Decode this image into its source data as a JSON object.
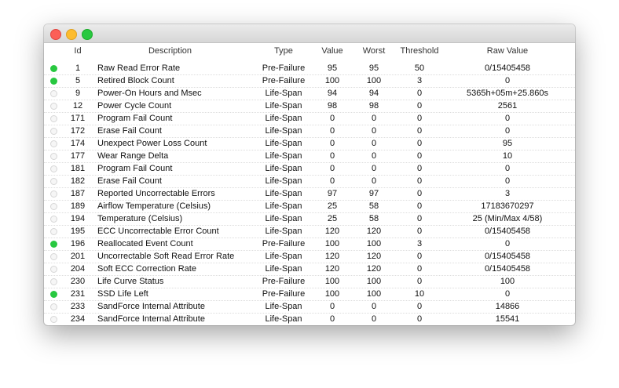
{
  "colors": {
    "status_ok": "#28c840"
  },
  "columns": {
    "id": "Id",
    "description": "Description",
    "type": "Type",
    "value": "Value",
    "worst": "Worst",
    "threshold": "Threshold",
    "raw": "Raw Value"
  },
  "rows": [
    {
      "status": "ok",
      "id": "1",
      "description": "Raw Read Error Rate",
      "type": "Pre-Failure",
      "value": "95",
      "worst": "95",
      "threshold": "50",
      "raw": "0/15405458"
    },
    {
      "status": "ok",
      "id": "5",
      "description": "Retired Block Count",
      "type": "Pre-Failure",
      "value": "100",
      "worst": "100",
      "threshold": "3",
      "raw": "0"
    },
    {
      "status": "off",
      "id": "9",
      "description": "Power-On Hours and Msec",
      "type": "Life-Span",
      "value": "94",
      "worst": "94",
      "threshold": "0",
      "raw": "5365h+05m+25.860s"
    },
    {
      "status": "off",
      "id": "12",
      "description": "Power Cycle Count",
      "type": "Life-Span",
      "value": "98",
      "worst": "98",
      "threshold": "0",
      "raw": "2561"
    },
    {
      "status": "off",
      "id": "171",
      "description": "Program Fail Count",
      "type": "Life-Span",
      "value": "0",
      "worst": "0",
      "threshold": "0",
      "raw": "0"
    },
    {
      "status": "off",
      "id": "172",
      "description": "Erase Fail Count",
      "type": "Life-Span",
      "value": "0",
      "worst": "0",
      "threshold": "0",
      "raw": "0"
    },
    {
      "status": "off",
      "id": "174",
      "description": "Unexpect Power Loss Count",
      "type": "Life-Span",
      "value": "0",
      "worst": "0",
      "threshold": "0",
      "raw": "95"
    },
    {
      "status": "off",
      "id": "177",
      "description": "Wear Range Delta",
      "type": "Life-Span",
      "value": "0",
      "worst": "0",
      "threshold": "0",
      "raw": "10"
    },
    {
      "status": "off",
      "id": "181",
      "description": "Program Fail Count",
      "type": "Life-Span",
      "value": "0",
      "worst": "0",
      "threshold": "0",
      "raw": "0"
    },
    {
      "status": "off",
      "id": "182",
      "description": "Erase Fail Count",
      "type": "Life-Span",
      "value": "0",
      "worst": "0",
      "threshold": "0",
      "raw": "0"
    },
    {
      "status": "off",
      "id": "187",
      "description": "Reported Uncorrectable Errors",
      "type": "Life-Span",
      "value": "97",
      "worst": "97",
      "threshold": "0",
      "raw": "3"
    },
    {
      "status": "off",
      "id": "189",
      "description": "Airflow Temperature (Celsius)",
      "type": "Life-Span",
      "value": "25",
      "worst": "58",
      "threshold": "0",
      "raw": "17183670297"
    },
    {
      "status": "off",
      "id": "194",
      "description": "Temperature (Celsius)",
      "type": "Life-Span",
      "value": "25",
      "worst": "58",
      "threshold": "0",
      "raw": "25 (Min/Max 4/58)"
    },
    {
      "status": "off",
      "id": "195",
      "description": "ECC Uncorrectable Error Count",
      "type": "Life-Span",
      "value": "120",
      "worst": "120",
      "threshold": "0",
      "raw": "0/15405458"
    },
    {
      "status": "ok",
      "id": "196",
      "description": "Reallocated Event Count",
      "type": "Pre-Failure",
      "value": "100",
      "worst": "100",
      "threshold": "3",
      "raw": "0"
    },
    {
      "status": "off",
      "id": "201",
      "description": "Uncorrectable Soft Read Error Rate",
      "type": "Life-Span",
      "value": "120",
      "worst": "120",
      "threshold": "0",
      "raw": "0/15405458"
    },
    {
      "status": "off",
      "id": "204",
      "description": "Soft ECC Correction Rate",
      "type": "Life-Span",
      "value": "120",
      "worst": "120",
      "threshold": "0",
      "raw": "0/15405458"
    },
    {
      "status": "off",
      "id": "230",
      "description": "Life Curve Status",
      "type": "Pre-Failure",
      "value": "100",
      "worst": "100",
      "threshold": "0",
      "raw": "100"
    },
    {
      "status": "ok",
      "id": "231",
      "description": "SSD Life Left",
      "type": "Pre-Failure",
      "value": "100",
      "worst": "100",
      "threshold": "10",
      "raw": "0"
    },
    {
      "status": "off",
      "id": "233",
      "description": "SandForce Internal Attribute",
      "type": "Life-Span",
      "value": "0",
      "worst": "0",
      "threshold": "0",
      "raw": "14866"
    },
    {
      "status": "off",
      "id": "234",
      "description": "SandForce Internal Attribute",
      "type": "Life-Span",
      "value": "0",
      "worst": "0",
      "threshold": "0",
      "raw": "15541"
    }
  ]
}
